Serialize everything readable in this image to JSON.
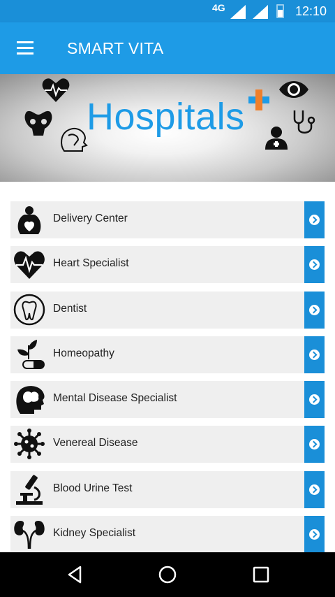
{
  "status_bar": {
    "network": "4G",
    "time": "12:10"
  },
  "app_bar": {
    "title": "SMART VITA"
  },
  "banner": {
    "title": "Hospitals"
  },
  "categories": [
    {
      "label": "Delivery Center",
      "icon": "mother-baby-icon"
    },
    {
      "label": "Heart Specialist",
      "icon": "heart-pulse-icon"
    },
    {
      "label": "Dentist",
      "icon": "tooth-icon"
    },
    {
      "label": "Homeopathy",
      "icon": "leaf-pill-icon"
    },
    {
      "label": "Mental Disease Specialist",
      "icon": "brain-head-icon"
    },
    {
      "label": "Venereal Disease",
      "icon": "virus-icon"
    },
    {
      "label": "Blood Urine Test",
      "icon": "microscope-icon"
    },
    {
      "label": "Kidney Specialist",
      "icon": "kidney-icon"
    }
  ],
  "colors": {
    "primary": "#1e9be6",
    "status": "#1a8fd8",
    "row_bg": "#efefef"
  }
}
